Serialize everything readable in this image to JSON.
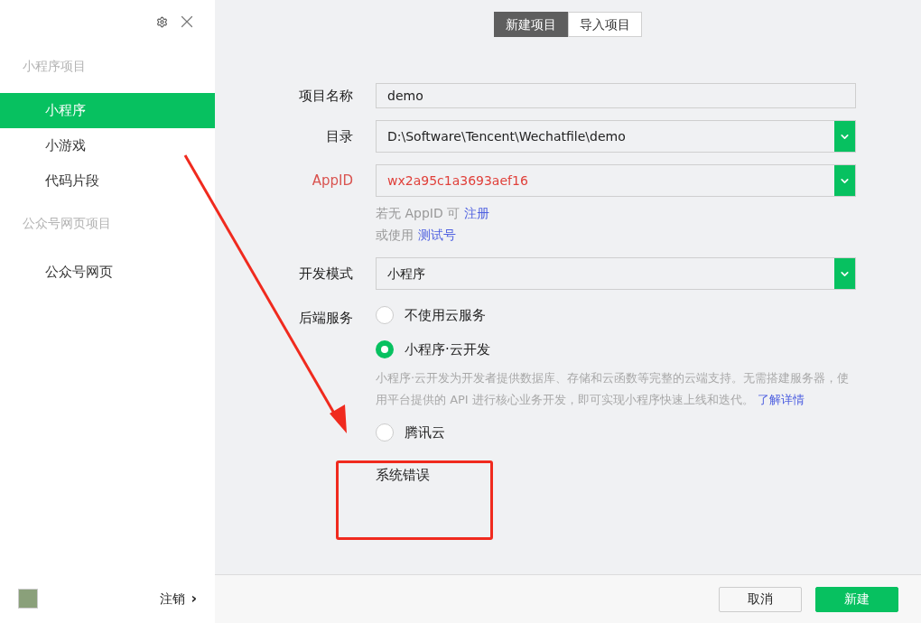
{
  "sidebar": {
    "sections": [
      {
        "title": "小程序项目",
        "items": [
          {
            "label": "小程序",
            "selected": true
          },
          {
            "label": "小游戏",
            "selected": false
          },
          {
            "label": "代码片段",
            "selected": false
          }
        ]
      },
      {
        "title": "公众号网页项目",
        "items": [
          {
            "label": "公众号网页",
            "selected": false
          }
        ]
      }
    ],
    "logout": "注销",
    "logout_arrow": "›"
  },
  "tabs": [
    {
      "label": "新建项目",
      "selected": true
    },
    {
      "label": "导入项目",
      "selected": false
    }
  ],
  "form": {
    "fields": [
      {
        "label": "项目名称",
        "value": "demo",
        "kind": "text",
        "error": false
      },
      {
        "label": "目录",
        "value": "D:\\Software\\Tencent\\Wechatfile\\demo",
        "kind": "select",
        "error": false
      },
      {
        "label": "AppID",
        "value": "wx2a95c1a3693aef16",
        "kind": "select",
        "error": true
      }
    ],
    "hints": [
      {
        "text": "若无 AppID 可",
        "link": "注册"
      },
      {
        "text": "或使用",
        "link": "测试号"
      }
    ],
    "mode": {
      "label": "开发模式",
      "value": "小程序",
      "kind": "select",
      "error": false
    },
    "backend": {
      "label": "后端服务",
      "options": [
        {
          "label": "不使用云服务",
          "selected": false
        },
        {
          "label": "小程序·云开发",
          "selected": true,
          "description": "小程序·云开发为开发者提供数据库、存储和云函数等完整的云端支持。无需搭建服务器，使用平台提供的 API 进行核心业务开发，即可实现小程序快速上线和迭代。",
          "link": "了解详情"
        },
        {
          "label": "腾讯云",
          "selected": false
        }
      ]
    },
    "error_message": "系统错误"
  },
  "buttons": [
    {
      "label": "取消",
      "kind": "secondary"
    },
    {
      "label": "新建",
      "kind": "primary"
    }
  ]
}
